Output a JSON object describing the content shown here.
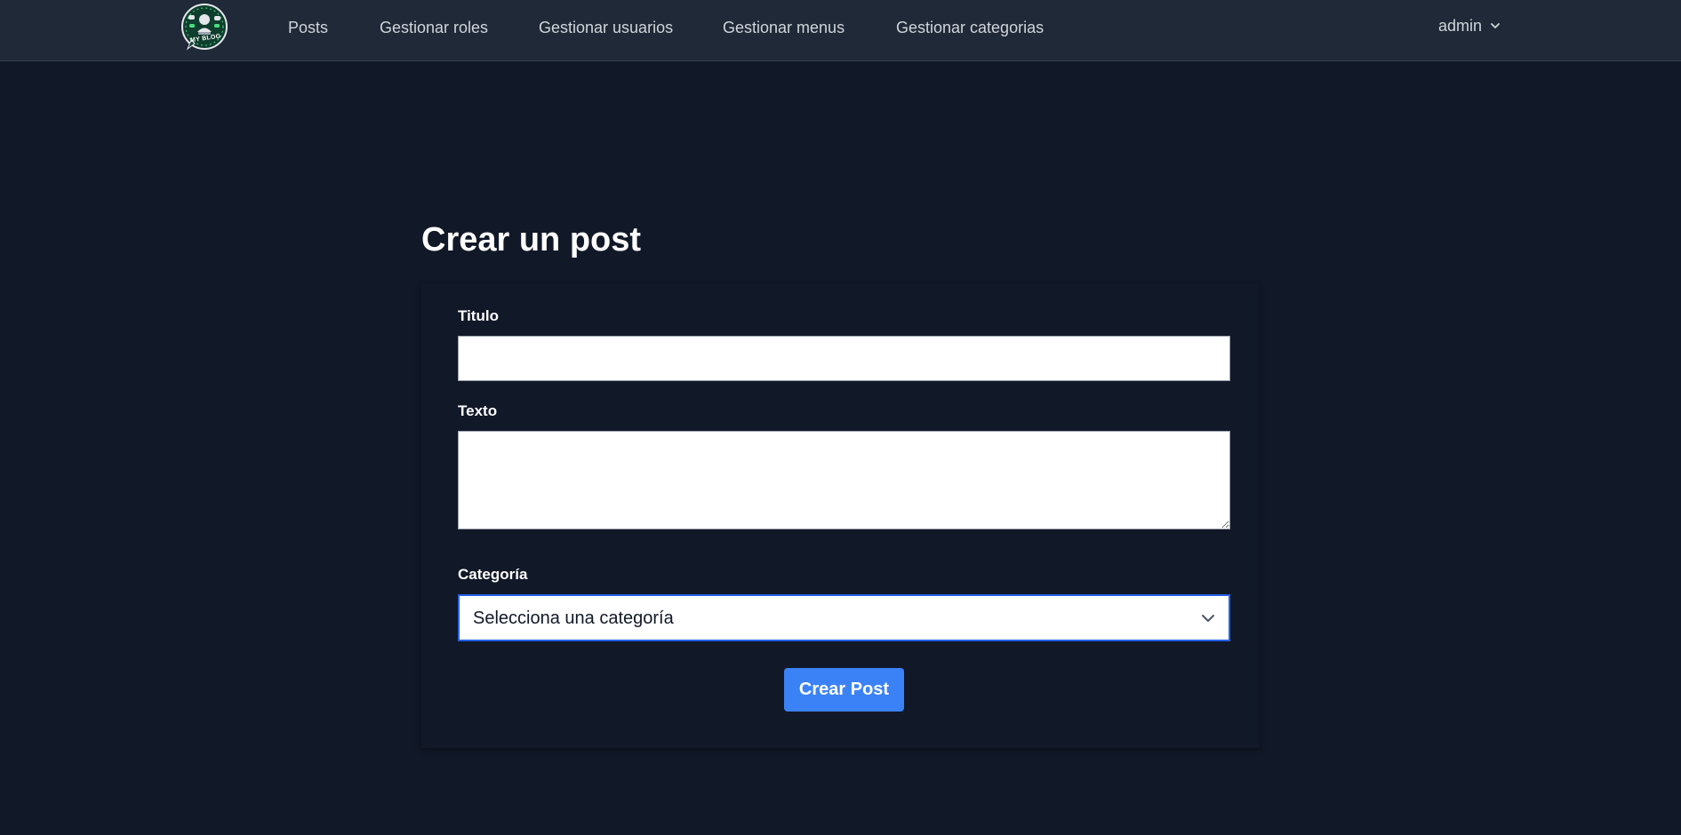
{
  "brand": {
    "logo_text": "MY BLOG",
    "logo_color": "#0f3d2e",
    "logo_accent": "#4ade80"
  },
  "nav": {
    "links": [
      {
        "label": "Posts"
      },
      {
        "label": "Gestionar roles"
      },
      {
        "label": "Gestionar usuarios"
      },
      {
        "label": "Gestionar menus"
      },
      {
        "label": "Gestionar categorias"
      }
    ],
    "user": {
      "name": "admin",
      "icon": "chevron-down-icon"
    }
  },
  "page": {
    "title": "Crear un post"
  },
  "form": {
    "title_label": "Titulo",
    "title_value": "",
    "text_label": "Texto",
    "text_value": "",
    "category_label": "Categoría",
    "category_selected": "Selecciona una categoría",
    "submit_label": "Crear Post"
  },
  "colors": {
    "background": "#111827",
    "navbar": "#1f2937",
    "accent": "#3b82f6",
    "focus_border": "#2563eb"
  }
}
